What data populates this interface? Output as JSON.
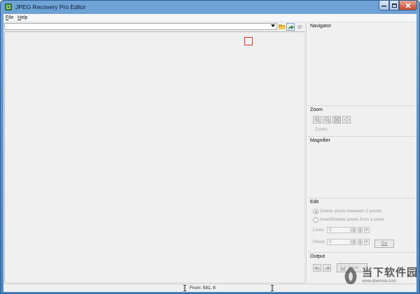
{
  "window": {
    "title": "JPEG Recovery Pro Editor"
  },
  "menu": [
    {
      "label": "File",
      "accel": "F",
      "rest": "ile"
    },
    {
      "label": "Help",
      "accel": "H",
      "rest": "elp"
    }
  ],
  "toolbar": {
    "path_value": "",
    "icons": [
      "open-folder-icon",
      "redo-arrow-icon",
      "disabled-tool-icon"
    ]
  },
  "panels": {
    "navigator_title": "Navigator",
    "zoom_title": "Zoom",
    "zoom_label": "Zoom:",
    "magnifier_title": "Magnifier",
    "edit_title": "Edit",
    "output_title": "Output"
  },
  "edit": {
    "option_delete": "Delete pixels between 2 points",
    "option_insert": "Insert/Delete pixels from a point",
    "selected_option": "Delete pixels between 2 points",
    "lines_label": "Lines",
    "lines_value": "0",
    "pixels_label": "Pixels",
    "pixels_value": "0",
    "go_label": "Go"
  },
  "output": {
    "save_label": "Save"
  },
  "status": {
    "from_text": "From: 581, 8"
  },
  "watermark": {
    "title": "当下软件园",
    "url": "www.downxia.com"
  },
  "colors": {
    "titlebar": "#5b93cc",
    "marker": "#e03030",
    "close_button": "#c9462f"
  }
}
